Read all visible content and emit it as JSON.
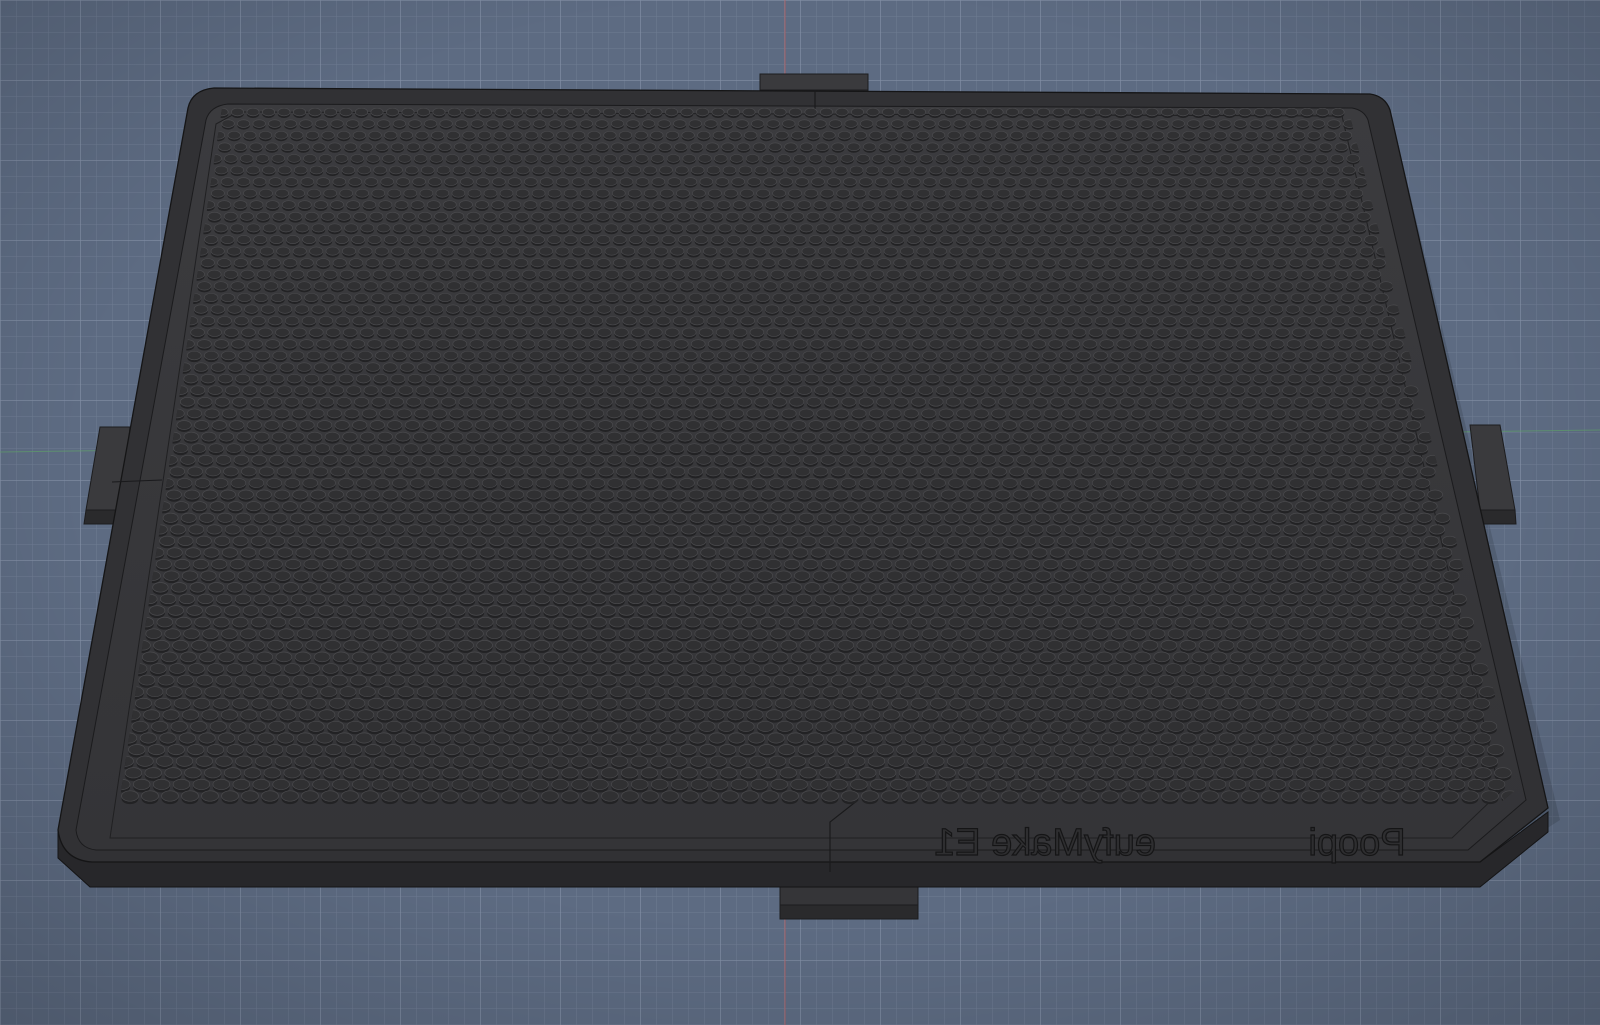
{
  "viewport": {
    "background_color": "#5d6b82",
    "grid_minor_color": "#6f7c93",
    "grid_major_color": "#8390a6",
    "axis_y_color": "#c25a5a",
    "axis_x_color": "#5fa06a"
  },
  "model": {
    "tray_color": "#333335",
    "floor_color": "#3a3a3c",
    "rim_color": "#2c2c2e",
    "peg_color": "#303032",
    "peg_rim_color": "#4a4a4d",
    "embossed_text": [
      "eufyMake E1",
      "Poopi"
    ]
  }
}
